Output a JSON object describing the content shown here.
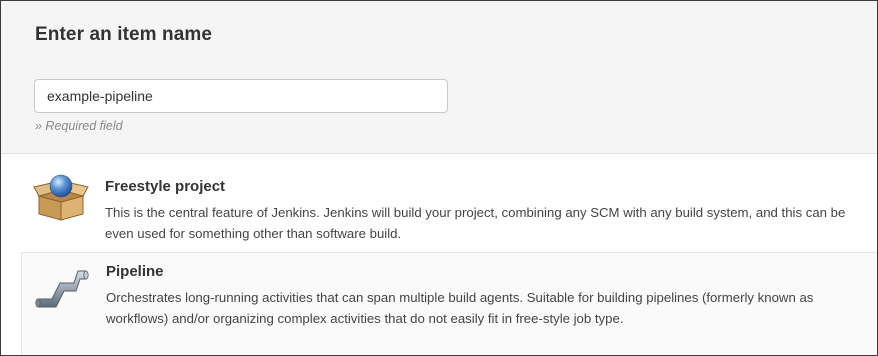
{
  "form": {
    "heading": "Enter an item name",
    "item_name_value": "example-pipeline",
    "required_note": "» Required field"
  },
  "item_types": [
    {
      "icon": "freestyle-project-icon",
      "title": "Freestyle project",
      "description": "This is the central feature of Jenkins. Jenkins will build your project, combining any SCM with any build system, and this can be even used for something other than software build."
    },
    {
      "icon": "pipeline-icon",
      "title": "Pipeline",
      "description": "Orchestrates long-running activities that can span multiple build agents. Suitable for building pipelines (formerly known as workflows) and/or organizing complex activities that do not easily fit in free-style job type."
    }
  ]
}
